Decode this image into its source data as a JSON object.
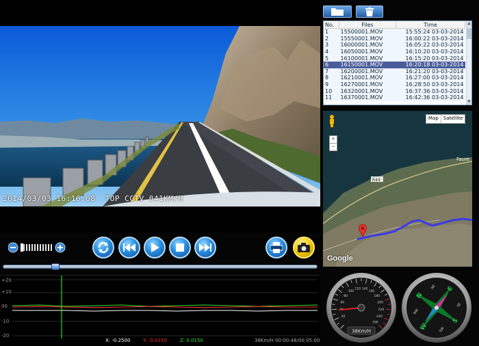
{
  "video": {
    "osd_date": "2014/03/03",
    "osd_time": "16:16:08",
    "osd_tag": "TOP CCTV",
    "osd_speed": "041KM/H"
  },
  "controls": {
    "volume_level": 0.5,
    "seek_position": 0.16,
    "icons": [
      "volume-down-icon",
      "volume-up-icon",
      "repeat-icon",
      "rewind-icon",
      "play-icon",
      "stop-icon",
      "fast-forward-icon",
      "print-icon",
      "camera-icon"
    ]
  },
  "graph": {
    "y_labels": [
      "+20",
      "+10",
      "00",
      "-10",
      "-20"
    ],
    "readout": {
      "x": "X: -0.2500",
      "y": "Y: -0.0150",
      "z": "Z: 0.0150",
      "status": "38Km/H 00:00:48/00:05:00"
    },
    "colors": {
      "x": "#ffffff",
      "y": "#ff3030",
      "z": "#30e030",
      "cursor": "#22dd22"
    }
  },
  "files": {
    "headers": [
      "No.",
      "Files",
      "Time"
    ],
    "rows": [
      {
        "no": "1",
        "file": "15500001.MOV",
        "time": "15:55:24 03-03-2014"
      },
      {
        "no": "2",
        "file": "15550001.MOV",
        "time": "16:00:22 03-03-2014"
      },
      {
        "no": "3",
        "file": "16000001.MOV",
        "time": "16:05:22 03-03-2014"
      },
      {
        "no": "4",
        "file": "16050001.MOV",
        "time": "16:10:20 03-03-2014"
      },
      {
        "no": "5",
        "file": "16100001.MOV",
        "time": "16:15:20 03-03-2014"
      },
      {
        "no": "6",
        "file": "16150001.MOV",
        "time": "16:20:18 03-03-2014"
      },
      {
        "no": "7",
        "file": "16200001.MOV",
        "time": "16:21:20 03-03-2014"
      },
      {
        "no": "8",
        "file": "16210001.MOV",
        "time": "16:27:00 03-03-2014"
      },
      {
        "no": "9",
        "file": "16270001.MOV",
        "time": "16:28:50 03-03-2014"
      },
      {
        "no": "10",
        "file": "16320001.MOV",
        "time": "16:37:36 03-03-2014"
      },
      {
        "no": "11",
        "file": "16370001.MOV",
        "time": "16:42:36 03-03-2014"
      }
    ],
    "selected_index": 5
  },
  "map": {
    "map_label": "Map",
    "satellite_label": "Satellite",
    "road_label": "R44",
    "place_label": "Faure",
    "logo": "Google",
    "icons": [
      "pegman-icon",
      "zoom-in-icon",
      "zoom-out-icon",
      "map-pin-icon"
    ]
  },
  "gauges": {
    "speedometer": {
      "value": 38,
      "max": 260,
      "readout": "38Km/H",
      "ticks": [
        "20",
        "40",
        "60",
        "80",
        "100",
        "120",
        "140",
        "160",
        "180",
        "200",
        "220",
        "240",
        "260"
      ]
    },
    "compass": {
      "labels": [
        "N",
        "NE",
        "E",
        "SE",
        "S",
        "SW",
        "W",
        "NW"
      ]
    }
  }
}
